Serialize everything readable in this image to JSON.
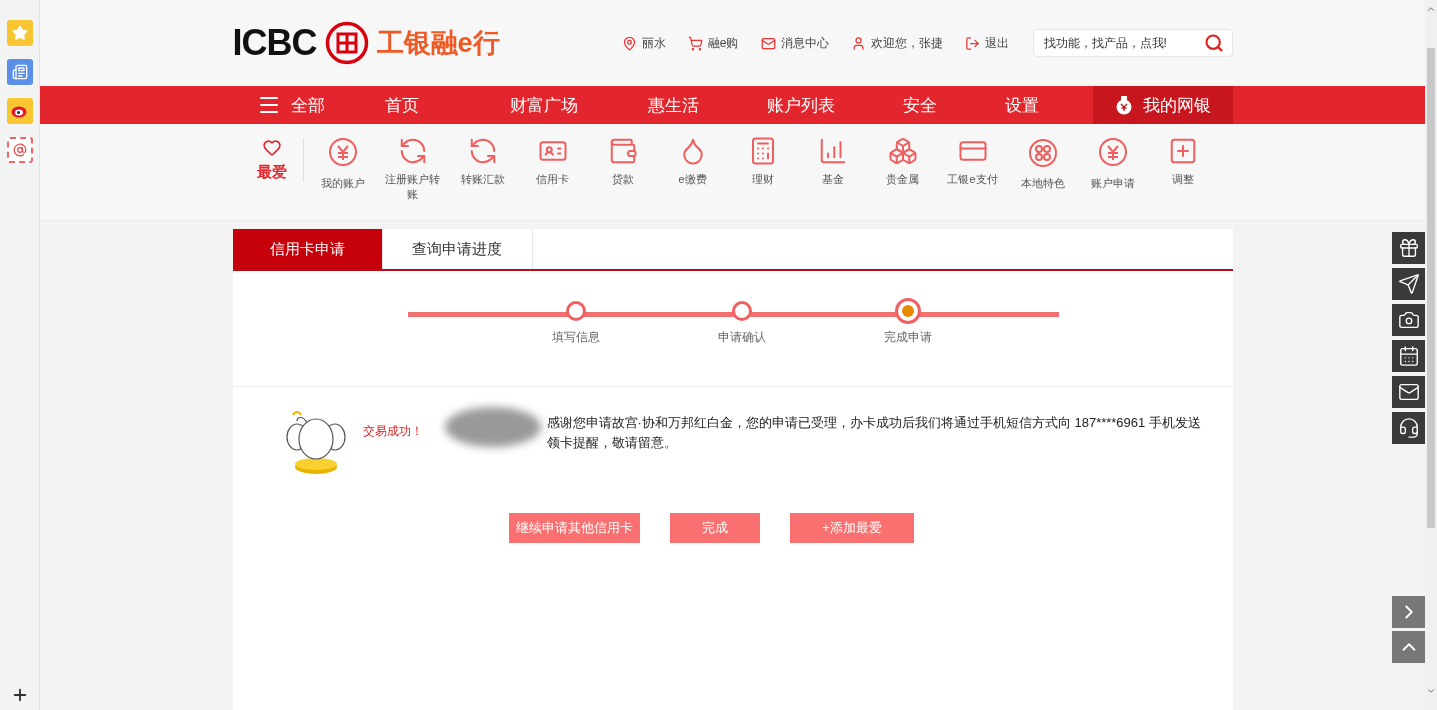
{
  "logo": {
    "abbr": "ICBC",
    "name": "工银融e行"
  },
  "top_links": [
    {
      "label": "丽水"
    },
    {
      "label": "融e购"
    },
    {
      "label": "消息中心"
    },
    {
      "label": "欢迎您，张捷"
    },
    {
      "label": "退出"
    }
  ],
  "search": {
    "placeholder": "找功能，找产品，点我!"
  },
  "nav": [
    {
      "label": "全部",
      "kind": "menu",
      "selected": false
    },
    {
      "label": "首页",
      "kind": "link",
      "selected": false
    },
    {
      "label": "财富广场",
      "kind": "link",
      "selected": false
    },
    {
      "label": "惠生活",
      "kind": "link",
      "selected": false
    },
    {
      "label": "账户列表",
      "kind": "link",
      "selected": false
    },
    {
      "label": "安全",
      "kind": "link",
      "selected": false
    },
    {
      "label": "设置",
      "kind": "link",
      "selected": false
    },
    {
      "label": "我的网银",
      "kind": "account",
      "selected": true
    }
  ],
  "favorite": {
    "label": "最爱"
  },
  "shortcuts": [
    {
      "label": "我的账户"
    },
    {
      "label": "注册账户转账"
    },
    {
      "label": "转账汇款"
    },
    {
      "label": "信用卡"
    },
    {
      "label": "贷款"
    },
    {
      "label": "e缴费"
    },
    {
      "label": "理财"
    },
    {
      "label": "基金"
    },
    {
      "label": "贵金属"
    },
    {
      "label": "工银e支付"
    },
    {
      "label": "本地特色"
    },
    {
      "label": "账户申请"
    },
    {
      "label": "调整"
    }
  ],
  "tabs": [
    {
      "label": "信用卡申请",
      "selected": true
    },
    {
      "label": "查询申请进度",
      "selected": false
    }
  ],
  "steps": [
    {
      "label": "填写信息",
      "selected": false
    },
    {
      "label": "申请确认",
      "selected": false
    },
    {
      "label": "完成申请",
      "selected": true
    }
  ],
  "result": {
    "status": "交易成功！",
    "message": "感谢您申请故宫·协和万邦红白金，您的申请已受理，办卡成功后我们将通过手机短信方式向 187****6961 手机发送领卡提醒，敬请留意。"
  },
  "buttons": [
    {
      "label": "继续申请其他信用卡"
    },
    {
      "label": "完成"
    },
    {
      "label": "+添加最爱"
    }
  ]
}
